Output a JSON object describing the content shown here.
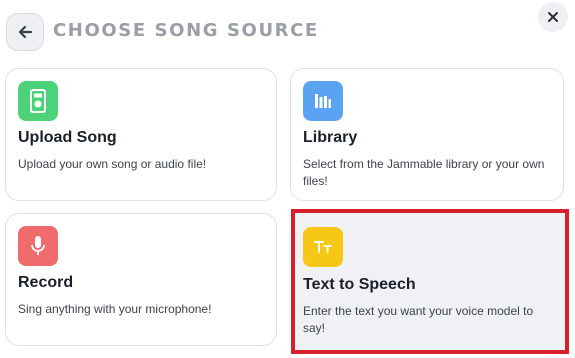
{
  "header": {
    "back_icon": "arrow-left-icon",
    "title": "CHOOSE SONG SOURCE",
    "close_icon": "close-icon"
  },
  "options": [
    {
      "name": "Upload Song",
      "description": "Upload your own song or audio file!",
      "icon": "music-player-icon",
      "icon_bg": "#4cd37a"
    },
    {
      "name": "Library",
      "description": "Select from the Jammable library or your own files!",
      "icon": "library-icon",
      "icon_bg": "#5aa3f2"
    },
    {
      "name": "Record",
      "description": "Sing anything with your microphone!",
      "icon": "microphone-icon",
      "icon_bg": "#f06c6c"
    },
    {
      "name": "Text to Speech",
      "description": "Enter the text you want your voice model to say!",
      "icon": "text-size-icon",
      "icon_bg": "#f7c718"
    }
  ],
  "colors": {
    "highlight_border": "#d7202c",
    "title_gray": "#9a9ea6"
  }
}
